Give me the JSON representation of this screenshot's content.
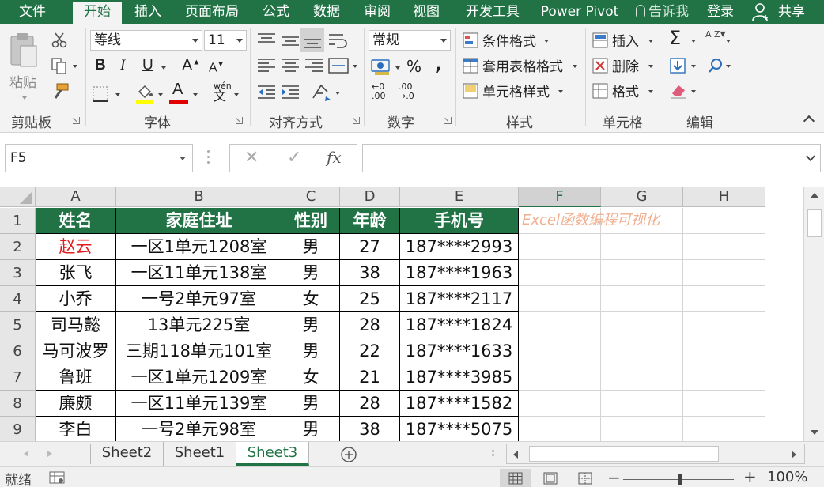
{
  "ribbon_tabs": [
    {
      "label": "文件"
    },
    {
      "label": "开始"
    },
    {
      "label": "插入"
    },
    {
      "label": "页面布局"
    },
    {
      "label": "公式"
    },
    {
      "label": "数据"
    },
    {
      "label": "审阅"
    },
    {
      "label": "视图"
    },
    {
      "label": "开发工具"
    },
    {
      "label": "Power Pivot"
    }
  ],
  "active_tab": "开始",
  "tell_me": "告诉我",
  "login": "登录",
  "share": "共享",
  "clipboard": {
    "paste": "粘贴",
    "group": "剪贴板"
  },
  "font": {
    "name": "等线",
    "size": "11",
    "bold": "B",
    "italic": "I",
    "underline": "U",
    "grow": "A",
    "shrink": "A",
    "font_color_letter": "A",
    "phonetic_top": "wén",
    "phonetic_bottom": "文",
    "group": "字体",
    "fill_color": "#ffff00",
    "font_color": "#e00000"
  },
  "alignment": {
    "group": "对齐方式"
  },
  "number": {
    "format": "常规",
    "percent": "%",
    "comma": ",",
    "inc": "←0",
    "inc2": ".00",
    "dec": ".00",
    "dec2": "→.0",
    "group": "数字"
  },
  "styles": {
    "conditional": "条件格式",
    "table": "套用表格格式",
    "cell": "单元格样式",
    "group": "样式"
  },
  "cells": {
    "insert": "插入",
    "delete": "删除",
    "format": "格式",
    "group": "单元格"
  },
  "editing": {
    "sum": "Σ",
    "sort": "A Z",
    "group": "编辑"
  },
  "name_box": "F5",
  "formula_bar": {
    "cancel": "✕",
    "enter": "✓",
    "fx": "fx",
    "content": ""
  },
  "columns": [
    "A",
    "B",
    "C",
    "D",
    "E",
    "F",
    "G",
    "H"
  ],
  "selected_column": "F",
  "rows": [
    "1",
    "2",
    "3",
    "4",
    "5",
    "6",
    "7",
    "8",
    "9"
  ],
  "table": {
    "headers": [
      "姓名",
      "家庭住址",
      "性别",
      "年龄",
      "手机号"
    ],
    "records": [
      [
        "赵云",
        "一区1单元1208室",
        "男",
        "27",
        "187****2993"
      ],
      [
        "张飞",
        "一区11单元138室",
        "男",
        "38",
        "187****1963"
      ],
      [
        "小乔",
        "一号2单元97室",
        "女",
        "25",
        "187****2117"
      ],
      [
        "司马懿",
        "13单元225室",
        "男",
        "28",
        "187****1824"
      ],
      [
        "马可波罗",
        "三期118单元101室",
        "男",
        "22",
        "187****1633"
      ],
      [
        "鲁班",
        "一区1单元1209室",
        "女",
        "21",
        "187****3985"
      ],
      [
        "廉颇",
        "一区11单元139室",
        "男",
        "28",
        "187****1582"
      ],
      [
        "李白",
        "一号2单元98室",
        "男",
        "38",
        "187****5075"
      ]
    ],
    "header_color": "#217346",
    "highlight_color": "#e02020"
  },
  "watermark": "Excel函数编程可视化",
  "sheets": [
    "Sheet2",
    "Sheet1",
    "Sheet3"
  ],
  "active_sheet": "Sheet3",
  "status": "就绪",
  "zoom": "100%",
  "accent_color": "#217346"
}
